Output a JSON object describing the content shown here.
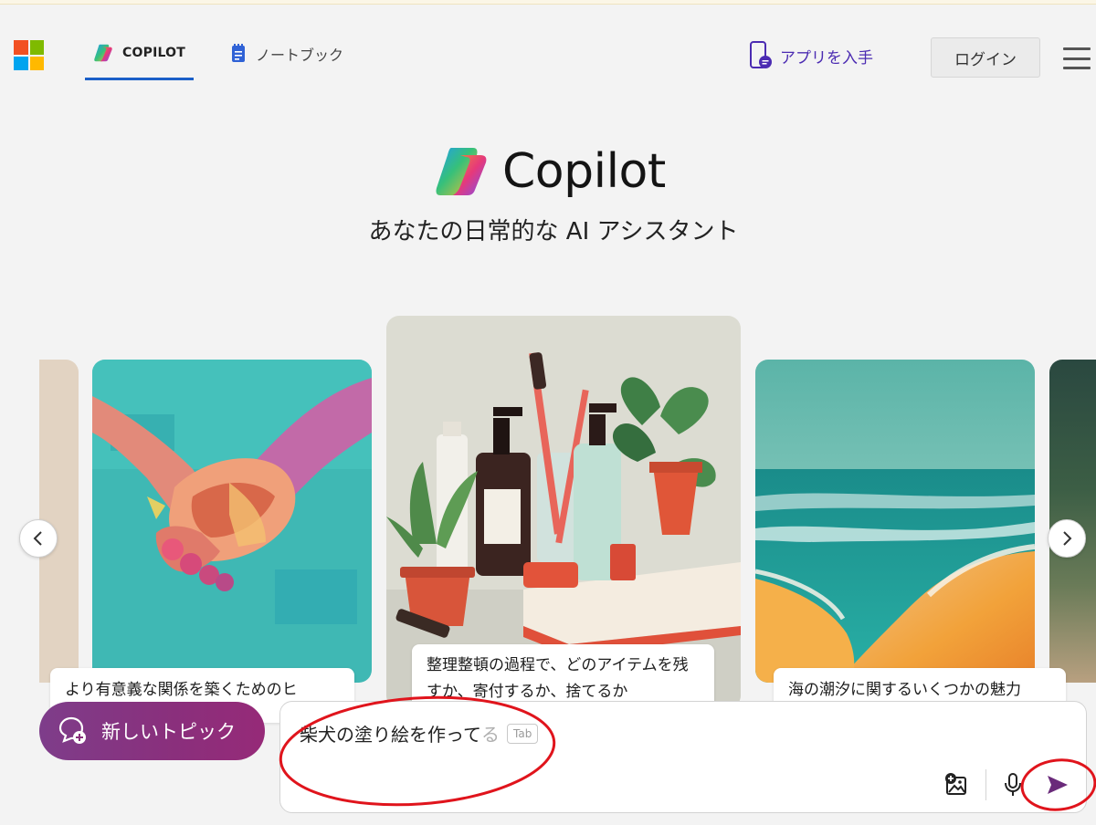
{
  "header": {
    "tabs": [
      {
        "label": "COPILOT",
        "active": true
      },
      {
        "label": "ノートブック",
        "active": false
      }
    ],
    "get_app_label": "アプリを入手",
    "login_label": "ログイン",
    "menu_icon": "hamburger-menu-icon"
  },
  "hero": {
    "title": "Copilot",
    "subtitle": "あなたの日常的な AI アシスタント"
  },
  "carousel": {
    "cards": [
      {
        "caption": "より有意義な関係を築くためのヒ"
      },
      {
        "caption": "整理整頓の過程で、どのアイテムを残すか、寄付するか、捨てるか"
      },
      {
        "caption": "海の潮汐に関するいくつかの魅力"
      }
    ],
    "prev_icon": "chevron-left-icon",
    "next_icon": "chevron-right-icon"
  },
  "new_topic_label": "新しいトピック",
  "composer": {
    "typed_text": "柴犬の塗り絵を作って",
    "suggestion_text": "る",
    "tab_hint": "Tab",
    "icons": [
      "image-upload-icon",
      "microphone-icon",
      "send-icon"
    ]
  },
  "colors": {
    "accent_blue": "#1a5fc8",
    "get_app_purple": "#4b2bb2",
    "new_topic_gradient_start": "#7e3d8a",
    "new_topic_gradient_end": "#962a78",
    "send_purple": "#6a2a7a",
    "annotation_red": "#e0141c"
  }
}
